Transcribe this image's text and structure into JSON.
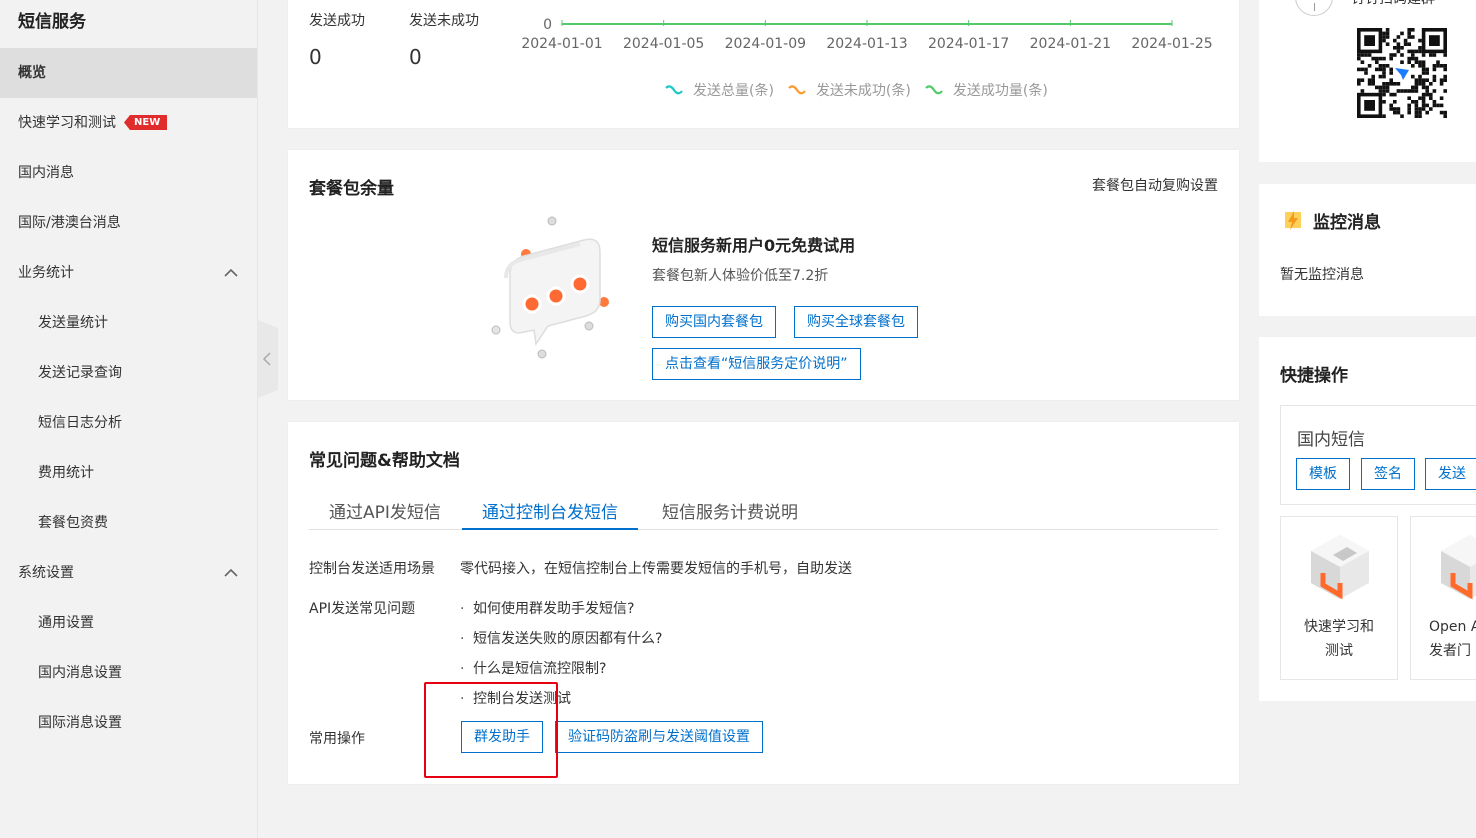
{
  "sidebar": {
    "title": "短信服务",
    "items": [
      {
        "label": "概览"
      },
      {
        "label": "快速学习和测试",
        "badge": "NEW"
      },
      {
        "label": "国内消息"
      },
      {
        "label": "国际/港澳台消息"
      },
      {
        "label": "业务统计"
      },
      {
        "label": "发送量统计"
      },
      {
        "label": "发送记录查询"
      },
      {
        "label": "短信日志分析"
      },
      {
        "label": "费用统计"
      },
      {
        "label": "套餐包资费"
      },
      {
        "label": "系统设置"
      },
      {
        "label": "通用设置"
      },
      {
        "label": "国内消息设置"
      },
      {
        "label": "国际消息设置"
      }
    ]
  },
  "stats": {
    "success_label": "发送成功",
    "success_value": "0",
    "fail_label": "发送未成功",
    "fail_value": "0"
  },
  "chart_data": {
    "type": "line",
    "y_tick": "0",
    "x": [
      "2024-01-01",
      "2024-01-05",
      "2024-01-09",
      "2024-01-13",
      "2024-01-17",
      "2024-01-21",
      "2024-01-25"
    ],
    "series": [
      {
        "name": "发送总量(条)",
        "color": "#1fc8c8",
        "values": [
          0,
          0,
          0,
          0,
          0,
          0,
          0
        ]
      },
      {
        "name": "发送未成功(条)",
        "color": "#ff9a2e",
        "values": [
          0,
          0,
          0,
          0,
          0,
          0,
          0
        ]
      },
      {
        "name": "发送成功量(条)",
        "color": "#52c96b",
        "values": [
          0,
          0,
          0,
          0,
          0,
          0,
          0
        ]
      }
    ]
  },
  "package": {
    "title": "套餐包余量",
    "auto_link": "套餐包自动复购设置",
    "promo_title": "短信服务新用户0元免费试用",
    "promo_sub": "套餐包新人体验价低至7.2折",
    "btn_domestic": "购买国内套餐包",
    "btn_global": "购买全球套餐包",
    "btn_pricing": "点击查看“短信服务定价说明”"
  },
  "faq": {
    "title": "常见问题&帮助文档",
    "tabs": [
      "通过API发短信",
      "通过控制台发短信",
      "短信服务计费说明"
    ],
    "scene_label": "控制台发送适用场景",
    "scene_text": "零代码接入，在短信控制台上传需要发短信的手机号，自助发送",
    "api_label": "API发送常见问题",
    "questions": [
      "如何使用群发助手发短信?",
      "短信发送失败的原因都有什么?",
      "什么是短信流控限制?",
      "控制台发送测试"
    ],
    "ops_label": "常用操作",
    "op_mass": "群发助手",
    "op_verify": "验证码防盗刷与发送阈值设置"
  },
  "right": {
    "dingtalk_text": "钉钉扫码建群",
    "monitor_title": "监控消息",
    "monitor_empty": "暂无监控消息",
    "quick_title": "快捷操作",
    "domestic_title": "国内短信",
    "btn_template": "模板",
    "btn_sign": "签名",
    "btn_send": "发送",
    "tile1_line1": "快速学习和",
    "tile1_line2": "测试",
    "tile2_line1": "Open A",
    "tile2_line2": "发者门"
  },
  "colors": {
    "accent": "#0070cc",
    "highlight": "#e60012",
    "badge": "#e02c2c"
  }
}
